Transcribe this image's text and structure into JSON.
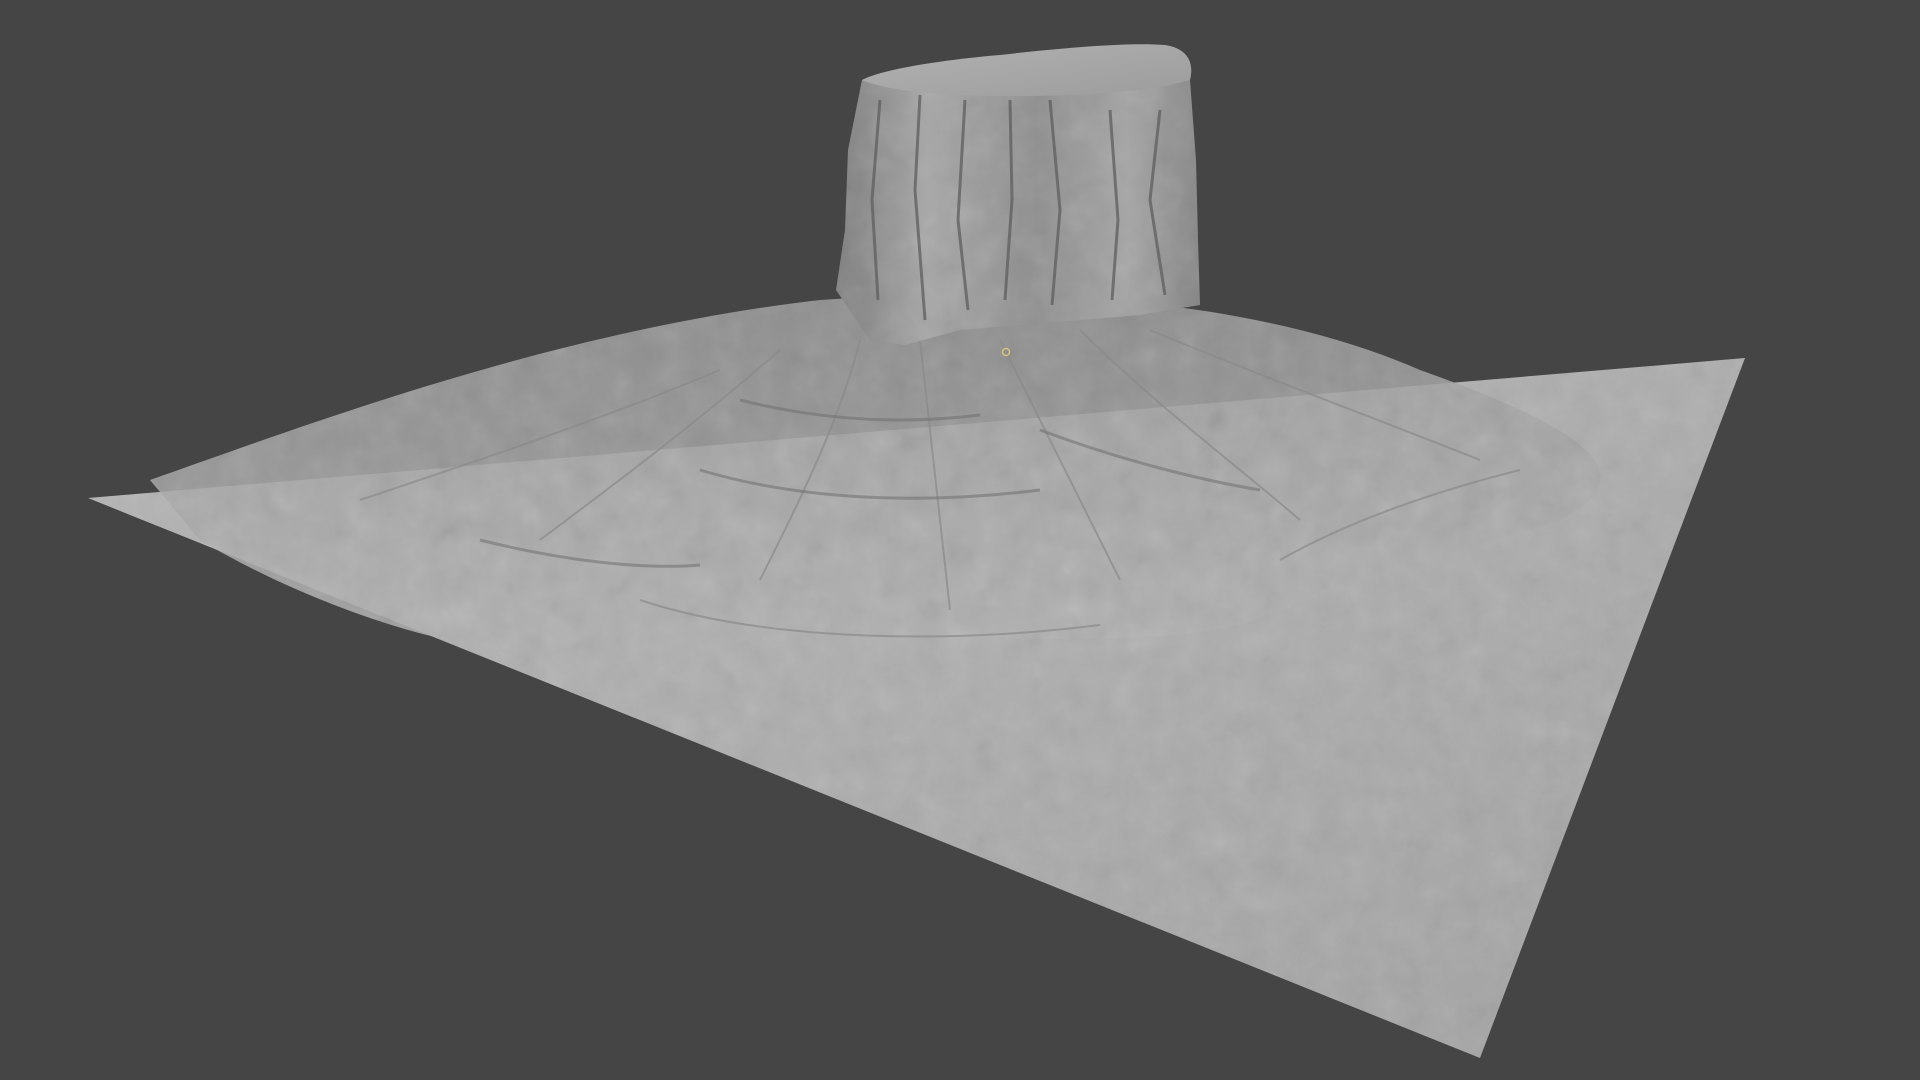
{
  "viewport": {
    "background_color": "#454545",
    "mesh_color": "#aaaaaa",
    "shade_light": "#c2c2c2",
    "shade_dark": "#5a5a5a",
    "origin_marker_color": "#d9c27a"
  }
}
